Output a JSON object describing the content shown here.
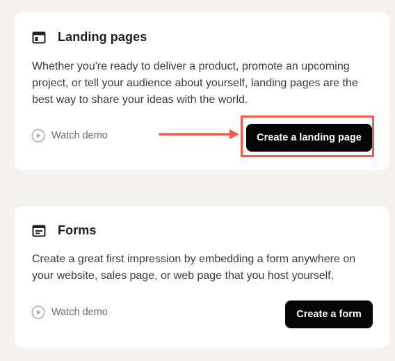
{
  "landing": {
    "icon": "layout-icon",
    "title": "Landing pages",
    "description": "Whether you're ready to deliver a product, promote an upcoming project, or tell your audience about yourself, landing pages are the best way to share your ideas with the world.",
    "watch_demo": "Watch demo",
    "cta": "Create a landing page"
  },
  "forms": {
    "icon": "form-icon",
    "title": "Forms",
    "description": "Create a great first impression by embedding a form anywhere on your website, sales page, or web page that you host yourself.",
    "watch_demo": "Watch demo",
    "cta": "Create a form"
  },
  "colors": {
    "page_bg": "#f3f2ef",
    "card_bg": "#ffffff",
    "button_bg": "#050505",
    "highlight": "#f05a4a",
    "muted_text": "#6b6b6b"
  }
}
